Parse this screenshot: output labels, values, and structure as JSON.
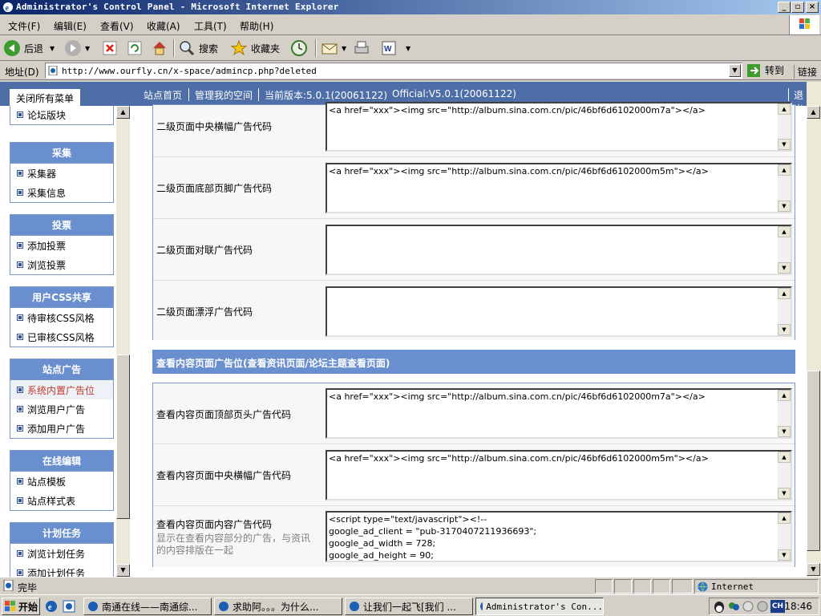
{
  "window": {
    "title": "Administrator's Control Panel - Microsoft Internet Explorer"
  },
  "menu": [
    "文件(F)",
    "编辑(E)",
    "查看(V)",
    "收藏(A)",
    "工具(T)",
    "帮助(H)"
  ],
  "toolbar": {
    "back": "后退",
    "search": "搜索",
    "favorites": "收藏夹"
  },
  "address": {
    "label": "地址(D)",
    "url": "http://www.ourfly.cn/x-space/admincp.php?deleted",
    "go": "转到",
    "links": "链接"
  },
  "topnav": {
    "close_all": "关闭所有菜单",
    "home": "站点首页",
    "my_space": "管理我的空间",
    "version": "当前版本:5.0.1(20061122)",
    "official": "Official:V5.0.1(20061122)",
    "logout": "退出"
  },
  "sidebar": {
    "partial_item": "论坛版块",
    "groups": [
      {
        "title": "采集",
        "items": [
          "采集器",
          "采集信息"
        ]
      },
      {
        "title": "投票",
        "items": [
          "添加投票",
          "浏览投票"
        ]
      },
      {
        "title": "用户CSS共享",
        "items": [
          "待审核CSS风格",
          "已审核CSS风格"
        ]
      },
      {
        "title": "站点广告",
        "items": [
          "系统内置广告位",
          "浏览用户广告",
          "添加用户广告"
        ]
      },
      {
        "title": "在线编辑",
        "items": [
          "站点模板",
          "站点样式表"
        ]
      },
      {
        "title": "计划任务",
        "items": [
          "浏览计划任务",
          "添加计划任务"
        ]
      }
    ]
  },
  "main": {
    "panel1": [
      {
        "label": "二级页面中央横幅广告代码",
        "value": "<a href=\"xxx\"><img src=\"http://album.sina.com.cn/pic/46bf6d6102000m7a\"></a>"
      },
      {
        "label": "二级页面底部页脚广告代码",
        "value": "<a href=\"xxx\"><img src=\"http://album.sina.com.cn/pic/46bf6d6102000m5m\"></a>"
      },
      {
        "label": "二级页面对联广告代码",
        "value": ""
      },
      {
        "label": "二级页面漂浮广告代码",
        "value": ""
      }
    ],
    "section2_title": "查看内容页面广告位(查看资讯页面/论坛主题查看页面)",
    "panel2": [
      {
        "label": "查看内容页面顶部页头广告代码",
        "hint": "",
        "value": "<a href=\"xxx\"><img src=\"http://album.sina.com.cn/pic/46bf6d6102000m7a\"></a>"
      },
      {
        "label": "查看内容页面中央横幅广告代码",
        "hint": "",
        "value": "<a href=\"xxx\"><img src=\"http://album.sina.com.cn/pic/46bf6d6102000m5m\"></a>"
      },
      {
        "label": "查看内容页面内容广告代码",
        "hint": "显示在查看内容部分的广告，与资讯的内容排版在一起",
        "value": "<script type=\"text/javascript\"><!--\ngoogle_ad_client = \"pub-3170407211936693\";\ngoogle_ad_width = 728;\ngoogle_ad_height = 90;"
      }
    ]
  },
  "status": {
    "text": "完毕",
    "zone": "Internet"
  },
  "taskbar": {
    "start": "开始",
    "tasks": [
      "南通在线——南通综...",
      "求助阿。。。为什么...",
      "让我们一起飞[我们 ...",
      "Administrator's Con..."
    ],
    "lang": "CH",
    "clock": "18:46"
  }
}
